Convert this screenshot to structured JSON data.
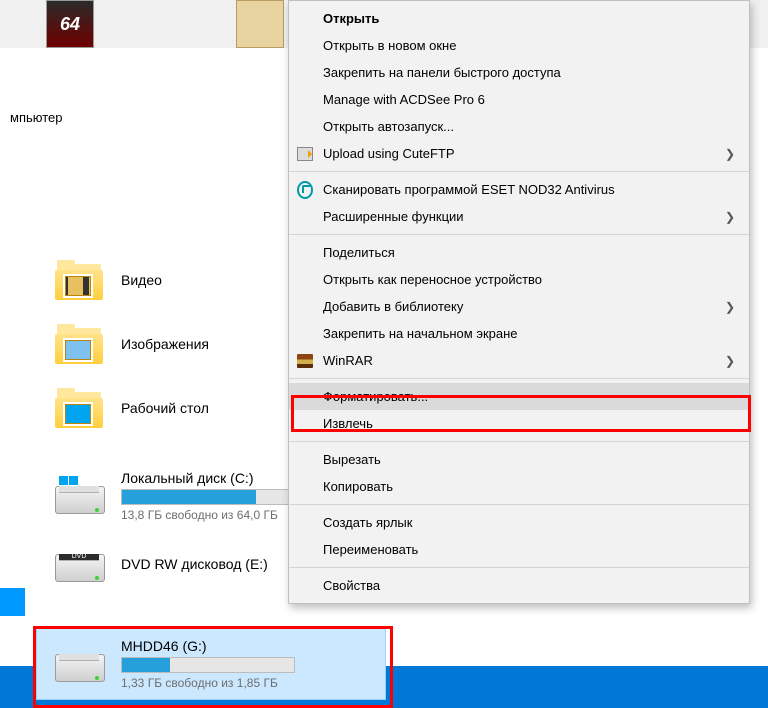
{
  "header": {
    "ic64_label": "64"
  },
  "crumb": "мпьютер",
  "folders": {
    "videos": "Видео",
    "images": "Изображения",
    "desktop": "Рабочий стол"
  },
  "drives": {
    "c": {
      "name": "Локальный диск (C:)",
      "sub": "13,8 ГБ свободно из 64,0 ГБ",
      "fill_pct": 78
    },
    "e": {
      "name": "DVD RW дисковод (E:)",
      "badge": "DVD"
    },
    "g": {
      "name": "MHDD46 (G:)",
      "sub": "1,33 ГБ свободно из 1,85 ГБ",
      "fill_pct": 28
    }
  },
  "menu": {
    "open": "Открыть",
    "open_new": "Открыть в новом окне",
    "pin_quick": "Закрепить на панели быстрого доступа",
    "acdsee": "Manage with ACDSee Pro 6",
    "autorun": "Открыть автозапуск...",
    "cuteftp": "Upload using CuteFTP",
    "eset": "Сканировать программой ESET NOD32 Antivirus",
    "advanced": "Расширенные функции",
    "share": "Поделиться",
    "portable": "Открыть как переносное устройство",
    "library": "Добавить в библиотеку",
    "pin_start": "Закрепить на начальном экране",
    "winrar": "WinRAR",
    "format": "Форматировать...",
    "eject": "Извлечь",
    "cut": "Вырезать",
    "copy": "Копировать",
    "shortcut": "Создать ярлык",
    "rename": "Переименовать",
    "properties": "Свойства"
  }
}
